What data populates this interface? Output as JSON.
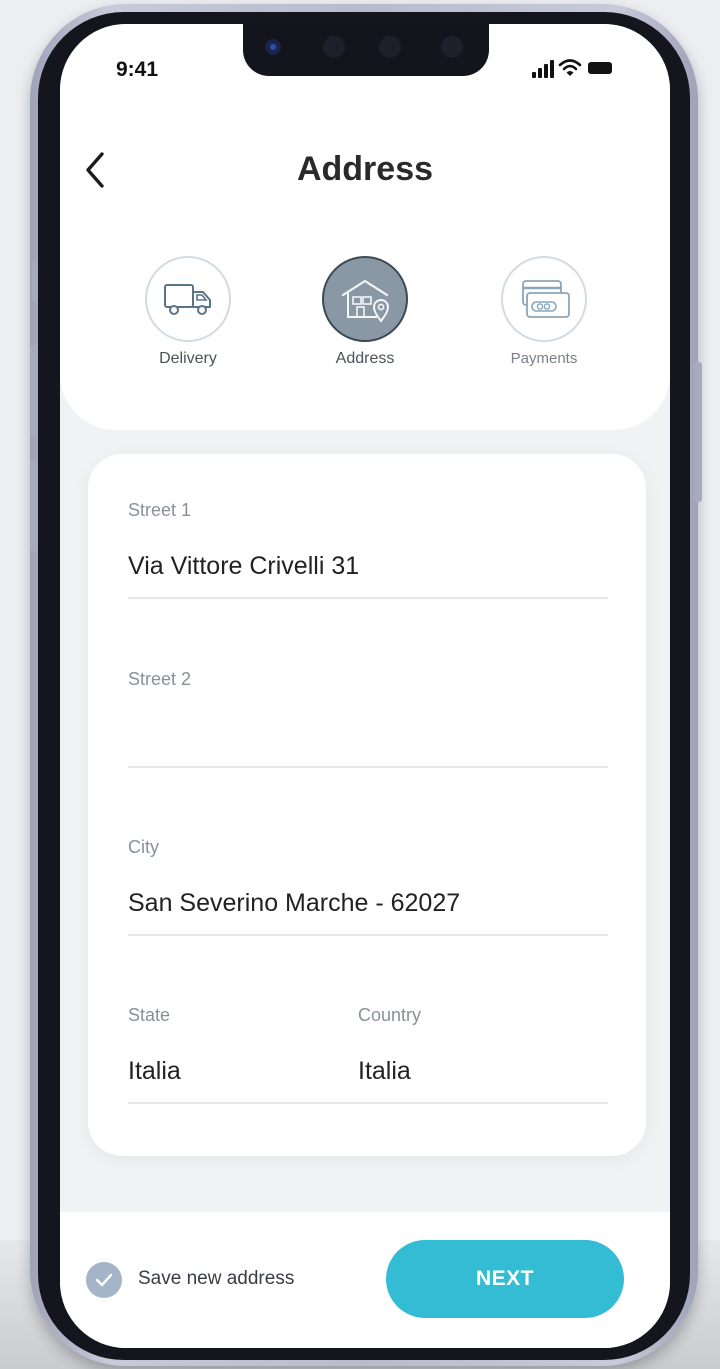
{
  "status_bar": {
    "time": "9:41"
  },
  "header": {
    "title": "Address"
  },
  "steps": [
    {
      "label": "Delivery",
      "icon": "truck-icon",
      "state": "done"
    },
    {
      "label": "Address",
      "icon": "house-location-icon",
      "state": "active"
    },
    {
      "label": "Payments",
      "icon": "credit-card-icon",
      "state": "pending"
    }
  ],
  "form": {
    "street1": {
      "label": "Street 1",
      "value": "Via Vittore Crivelli 31"
    },
    "street2": {
      "label": "Street 2",
      "value": ""
    },
    "city": {
      "label": "City",
      "value": "San Severino Marche - 62027"
    },
    "state": {
      "label": "State",
      "value": "Italia"
    },
    "country": {
      "label": "Country",
      "value": "Italia"
    }
  },
  "footer": {
    "save_label": "Save new address",
    "save_checked": true,
    "next_label": "NEXT"
  },
  "colors": {
    "accent": "#35bcd5",
    "check": "#a3b5c7",
    "active_step": "#8a98a6"
  }
}
